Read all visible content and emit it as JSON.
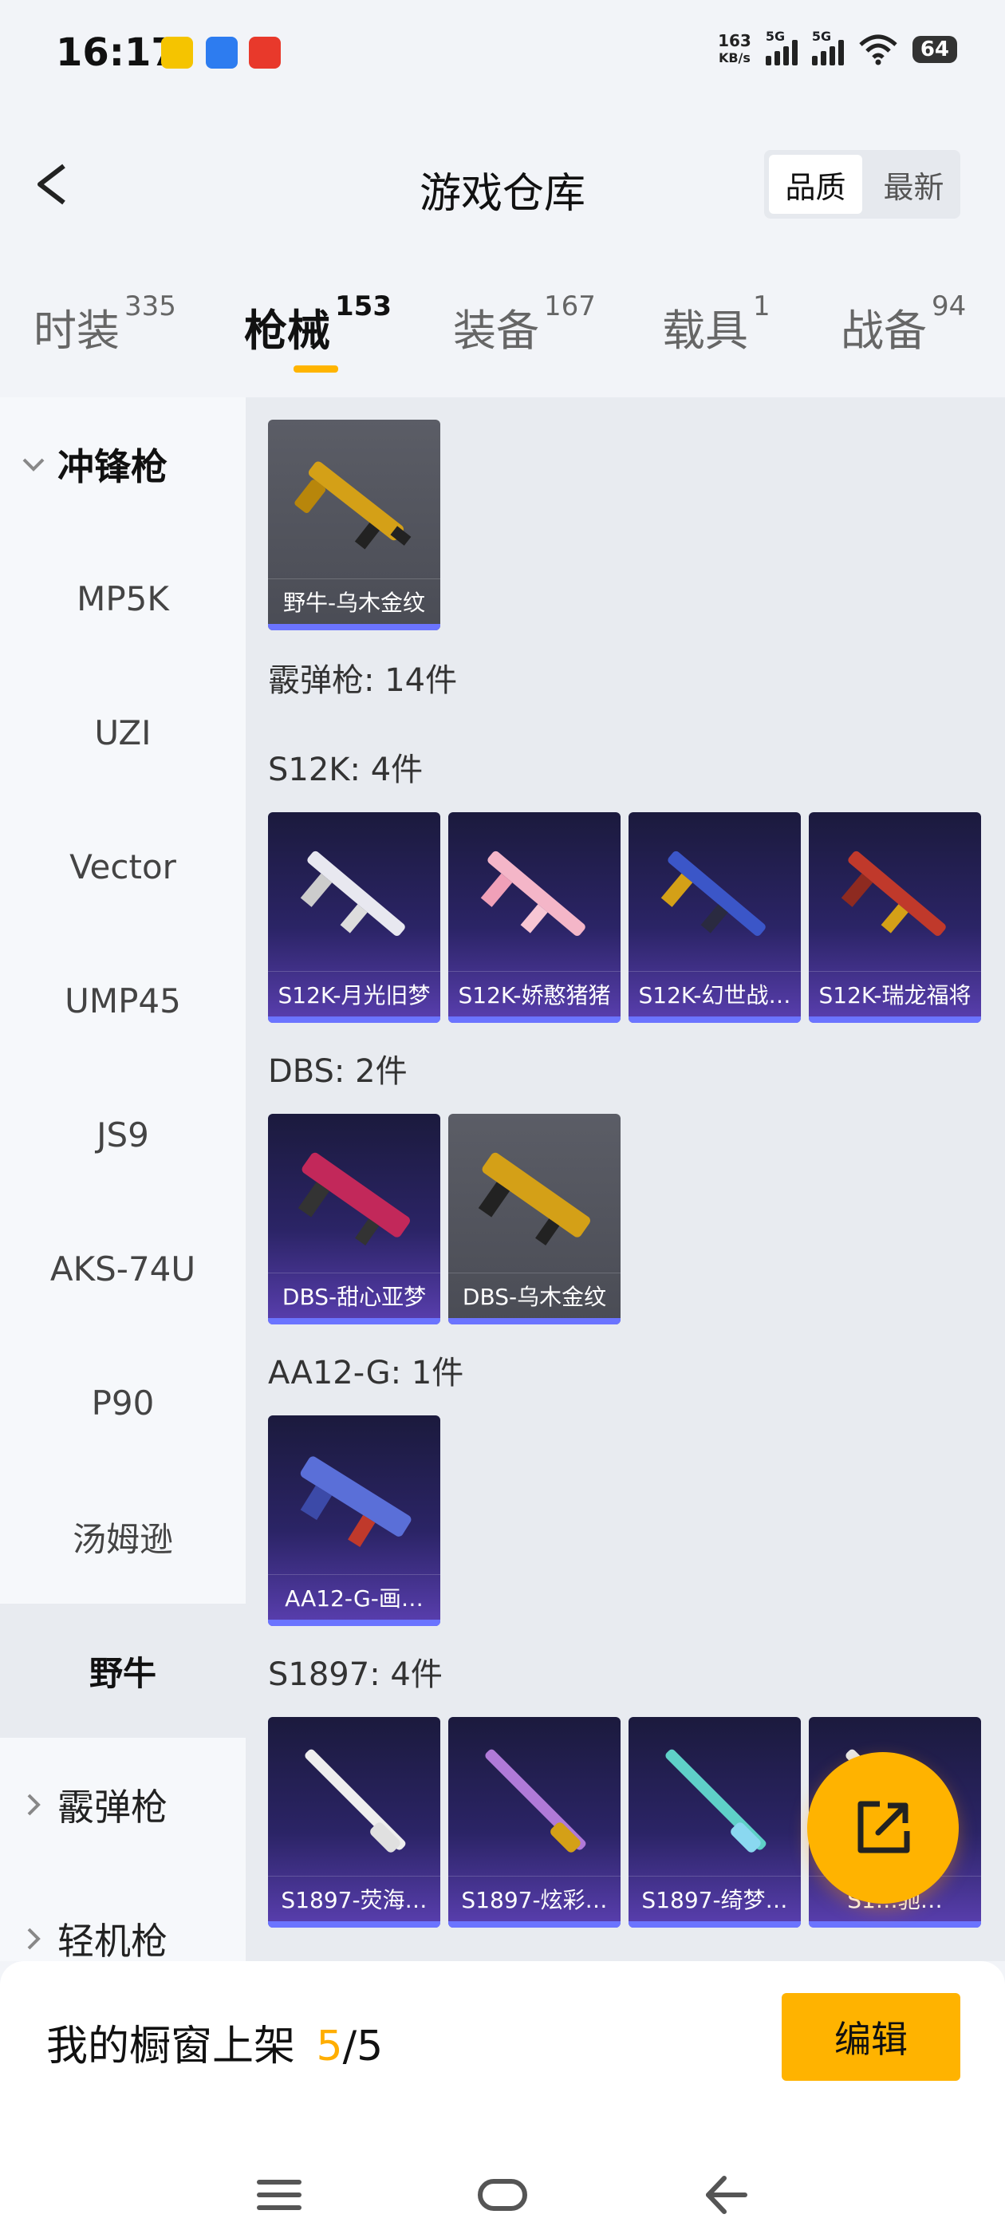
{
  "status_bar": {
    "time": "16:17",
    "net_speed_value": "163",
    "net_speed_unit": "KB/s",
    "signal1": "5G",
    "signal2": "5G",
    "battery": "64"
  },
  "header": {
    "title": "游戏仓库",
    "sort_options": [
      "品质",
      "最新"
    ],
    "sort_selected": "品质"
  },
  "tabs": [
    {
      "label": "时装",
      "count": "335"
    },
    {
      "label": "枪械",
      "count": "153",
      "active": true
    },
    {
      "label": "装备",
      "count": "167"
    },
    {
      "label": "载具",
      "count": "1"
    },
    {
      "label": "战备",
      "count": "94"
    }
  ],
  "sidebar": {
    "category_open": "冲锋枪",
    "items": [
      "MP5K",
      "UZI",
      "Vector",
      "UMP45",
      "JS9",
      "AKS-74U",
      "P90",
      "汤姆逊",
      "野牛"
    ],
    "selected": "野牛",
    "collapsed_categories": [
      "霰弹枪",
      "轻机枪"
    ]
  },
  "content": {
    "top_item": "野牛-乌木金纹",
    "shotgun_header": "霰弹枪: 14件",
    "groups": [
      {
        "label": "S12K: 4件",
        "items": [
          "S12K-月光旧梦",
          "S12K-娇憨猪猪",
          "S12K-幻世战…",
          "S12K-瑞龙福将"
        ]
      },
      {
        "label": "DBS: 2件",
        "items": [
          "DBS-甜心亚梦",
          "DBS-乌木金纹"
        ]
      },
      {
        "label": "AA12-G: 1件",
        "items": [
          "AA12-G-画…"
        ]
      },
      {
        "label": "S1897: 4件",
        "items": [
          "S1897-荧海…",
          "S1897-炫彩…",
          "S1897-绮梦…",
          "S1…驰…"
        ]
      }
    ]
  },
  "bottom": {
    "showcase_label": "我的橱窗上架",
    "showcase_current": "5",
    "showcase_total": "/5",
    "edit_label": "编辑"
  },
  "colors": {
    "accent": "#ffb300",
    "card_purple": "#2b2466",
    "card_grey": "#4a4c55",
    "rarity_bar": "#6b74ff"
  }
}
